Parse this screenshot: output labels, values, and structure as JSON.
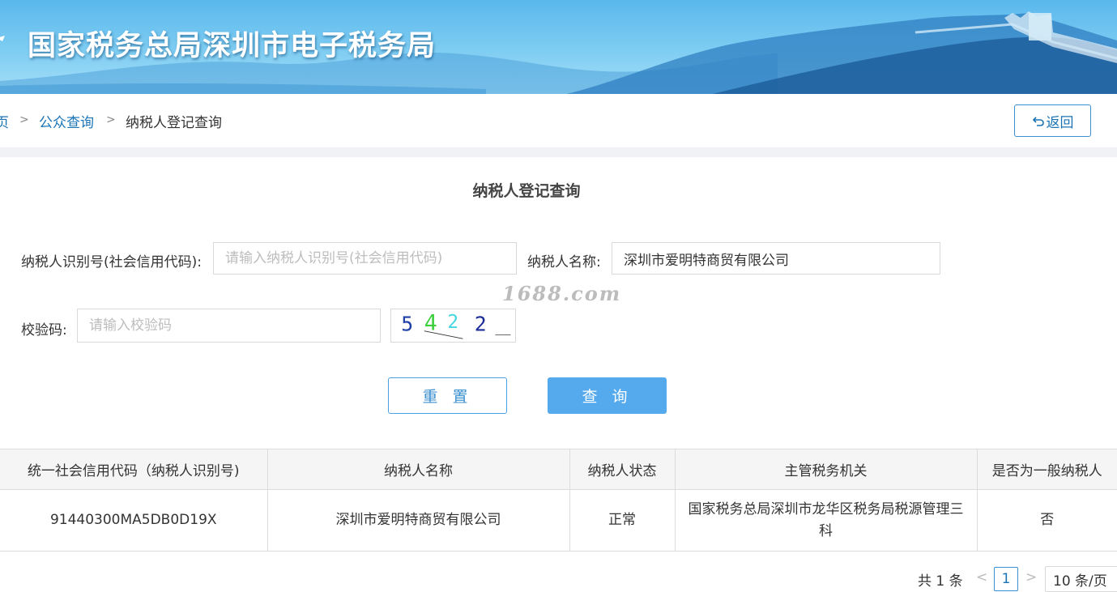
{
  "header": {
    "title": "国家税务总局深圳市电子税务局"
  },
  "breadcrumb": {
    "home": "页",
    "sep": ">",
    "public_query": "公众查询",
    "current": "纳税人登记查询"
  },
  "back_button": {
    "label": "返回"
  },
  "form": {
    "title": "纳税人登记查询",
    "taxpayer_id_label": "纳税人识别号(社会信用代码):",
    "taxpayer_id_placeholder": "请输入纳税人识别号(社会信用代码)",
    "taxpayer_id_value": "",
    "taxpayer_name_label": "纳税人名称:",
    "taxpayer_name_value": "深圳市爱明特商贸有限公司",
    "captcha_label": "校验码:",
    "captcha_placeholder": "请输入校验码",
    "captcha_image_text": [
      "5",
      "4",
      "2",
      "2"
    ],
    "reset_label": "重 置",
    "query_label": "查 询"
  },
  "watermark": "1688.com",
  "table": {
    "headers": [
      "统一社会信用代码（纳税人识别号)",
      "纳税人名称",
      "纳税人状态",
      "主管税务机关",
      "是否为一般纳税人"
    ],
    "rows": [
      [
        "91440300MA5DB0D19X",
        "深圳市爱明特商贸有限公司",
        "正常",
        "国家税务总局深圳市龙华区税务局税源管理三科",
        "否"
      ]
    ]
  },
  "pagination": {
    "total": "共 1 条",
    "prev": "<",
    "page": "1",
    "next": ">",
    "page_size": "10 条/页"
  },
  "colors": {
    "accent": "#1a73b5",
    "query_button": "#55aaed",
    "banner": "#5ab8ec"
  }
}
